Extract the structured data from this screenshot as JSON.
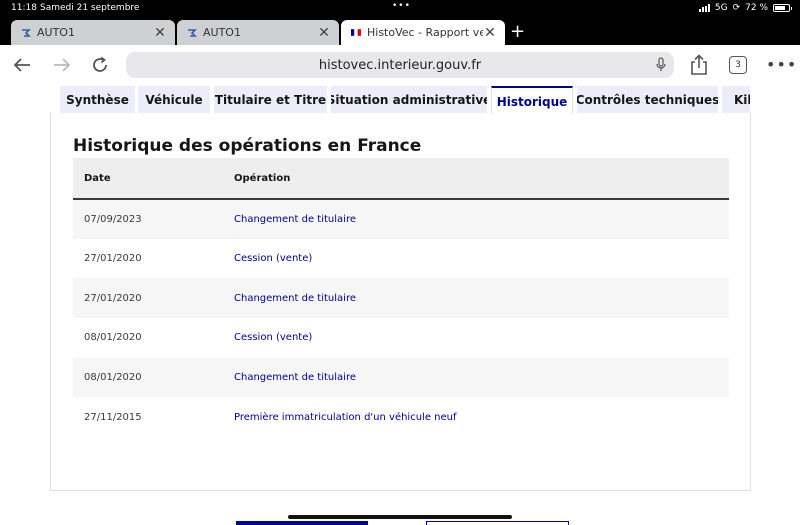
{
  "status_bar": {
    "time": "11:18",
    "date": "Samedi 21 septembre",
    "network": "5G",
    "battery": "72 %"
  },
  "browser_tabs": [
    {
      "title": "AUTO1",
      "favicon": "auto1-logo-icon",
      "active": false
    },
    {
      "title": "AUTO1",
      "favicon": "auto1-logo-icon",
      "active": false
    },
    {
      "title": "HistoVec - Rapport vende",
      "favicon": "french-flag-icon",
      "active": true
    }
  ],
  "address_bar": {
    "url": "histovec.interieur.gouv.fr",
    "tab_count": "3"
  },
  "page_tabs": [
    {
      "label": "Synthèse"
    },
    {
      "label": "Véhicule"
    },
    {
      "label": "Titulaire et Titre"
    },
    {
      "label": "Situation administrative"
    },
    {
      "label": "Historique",
      "active": true
    },
    {
      "label": "Contrôles techniques"
    },
    {
      "label": "Kilo"
    }
  ],
  "history": {
    "title": "Historique des opérations en France",
    "columns": {
      "date": "Date",
      "operation": "Opération"
    },
    "rows": [
      {
        "date": "07/09/2023",
        "operation": "Changement de titulaire"
      },
      {
        "date": "27/01/2020",
        "operation": "Cession (vente)"
      },
      {
        "date": "27/01/2020",
        "operation": "Changement de titulaire"
      },
      {
        "date": "08/01/2020",
        "operation": "Cession (vente)"
      },
      {
        "date": "08/01/2020",
        "operation": "Changement de titulaire"
      },
      {
        "date": "27/11/2015",
        "operation": "Première immatriculation d'un véhicule neuf"
      }
    ]
  },
  "colors": {
    "accent": "#000091",
    "tab_background": "#ecedf8",
    "stripe": "#f6f6f6"
  }
}
